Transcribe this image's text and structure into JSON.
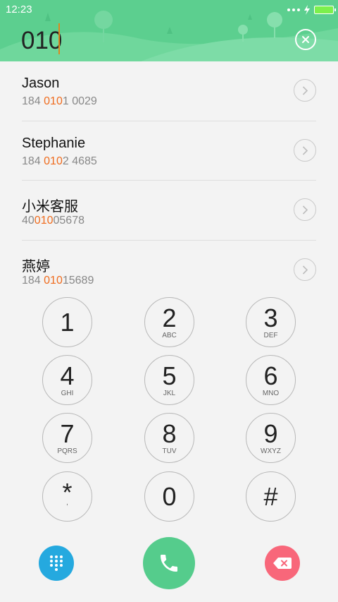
{
  "status_bar": {
    "time": "12:23"
  },
  "dialer": {
    "input_value": "010"
  },
  "contacts": [
    {
      "name": "Jason",
      "number_prefix": "184 ",
      "number_match": "010",
      "number_suffix": "1 0029"
    },
    {
      "name": "Stephanie",
      "number_prefix": "184 ",
      "number_match": "010",
      "number_suffix": "2 4685"
    },
    {
      "name": "小米客服",
      "number_prefix": "40",
      "number_match": "010",
      "number_suffix": "05678"
    },
    {
      "name": "燕婷",
      "number_prefix": "184 ",
      "number_match": "010",
      "number_suffix": "15689"
    }
  ],
  "keypad": [
    {
      "digit": "1",
      "letters": ""
    },
    {
      "digit": "2",
      "letters": "ABC"
    },
    {
      "digit": "3",
      "letters": "DEF"
    },
    {
      "digit": "4",
      "letters": "GHI"
    },
    {
      "digit": "5",
      "letters": "JKL"
    },
    {
      "digit": "6",
      "letters": "MNO"
    },
    {
      "digit": "7",
      "letters": "PQRS"
    },
    {
      "digit": "8",
      "letters": "TUV"
    },
    {
      "digit": "9",
      "letters": "WXYZ"
    },
    {
      "digit": "*",
      "letters": ","
    },
    {
      "digit": "0",
      "letters": ""
    },
    {
      "digit": "#",
      "letters": ""
    }
  ],
  "colors": {
    "header_green": "#5ccf8f",
    "match_highlight": "#ef6c1e",
    "keypad_toggle_blue": "#25a9df",
    "call_green": "#55cc8c",
    "delete_pink": "#f8677a"
  },
  "icons": {
    "clear": "clear-icon",
    "contact_arrow": "chevron-right-icon",
    "keypad_toggle": "dialpad-icon",
    "call": "phone-icon",
    "delete": "backspace-icon"
  }
}
